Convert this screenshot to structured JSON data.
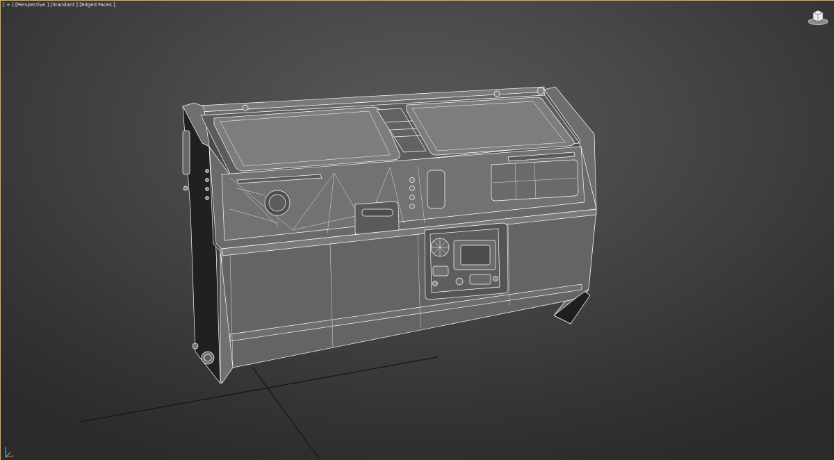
{
  "viewport": {
    "menu_label": "[ + ]",
    "view_label": "[Perspective ]",
    "shading_label": "[Standard ]",
    "display_label": "[Edged Faces ]"
  },
  "icons": {
    "viewcube": "viewcube-home-icon",
    "axis": "axis-tripod-icon"
  },
  "colors": {
    "active_viewport_border": "#e0b23a",
    "wireframe": "#ffffff",
    "grid_line": "#111111"
  }
}
